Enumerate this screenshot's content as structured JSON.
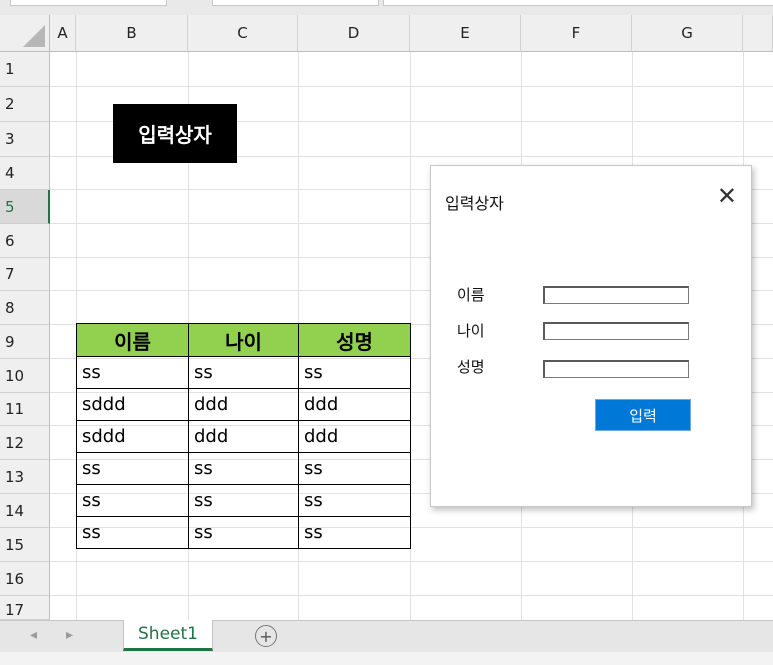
{
  "columns": [
    "A",
    "B",
    "C",
    "D",
    "E",
    "F",
    "G"
  ],
  "rows": [
    "1",
    "2",
    "3",
    "4",
    "5",
    "6",
    "7",
    "8",
    "9",
    "10",
    "11",
    "12",
    "13",
    "14",
    "15",
    "16",
    "17"
  ],
  "selected_row": "5",
  "title_box": "입력상자",
  "table": {
    "headers": [
      "이름",
      "나이",
      "성명"
    ],
    "header_color": "#92d050",
    "rows": [
      [
        "ss",
        "ss",
        "ss"
      ],
      [
        "sddd",
        "ddd",
        "ddd"
      ],
      [
        "sddd",
        "ddd",
        "ddd"
      ],
      [
        "ss",
        "ss",
        "ss"
      ],
      [
        "ss",
        "ss",
        "ss"
      ],
      [
        "ss",
        "ss",
        "ss"
      ]
    ]
  },
  "dialog": {
    "title": "입력상자",
    "close_icon": "close-icon",
    "labels": [
      "이름",
      "나이",
      "성명"
    ],
    "values": [
      "",
      "",
      ""
    ],
    "submit_label": "입력",
    "accent": "#0078d7"
  },
  "tabs": {
    "sheet_name": "Sheet1",
    "add_icon": "plus-circle-icon",
    "accent": "#217346"
  }
}
